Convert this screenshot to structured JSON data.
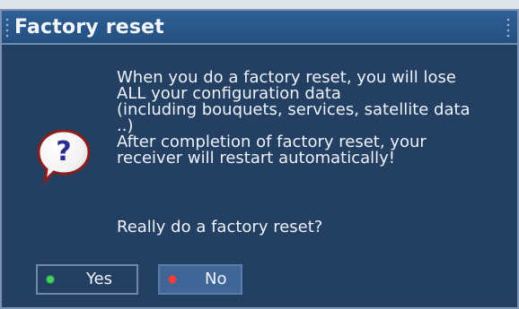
{
  "dialog": {
    "title": "Factory reset",
    "message_lines": [
      "When you do a factory reset, you will lose",
      "ALL your configuration data",
      "(including bouquets, services, satellite data",
      "..)",
      "After completion of factory reset, your",
      "receiver will restart automatically!"
    ],
    "question": "Really do a factory reset?",
    "icon": "question-icon",
    "buttons": {
      "yes": {
        "label": "Yes",
        "indicator_color": "#43d256"
      },
      "no": {
        "label": "No",
        "indicator_color": "#ff3a3a"
      }
    },
    "colors": {
      "background": "#233f61",
      "title_bar": "#2f5f97",
      "text": "#eef3fb",
      "selected_button": "#3f6696"
    }
  }
}
